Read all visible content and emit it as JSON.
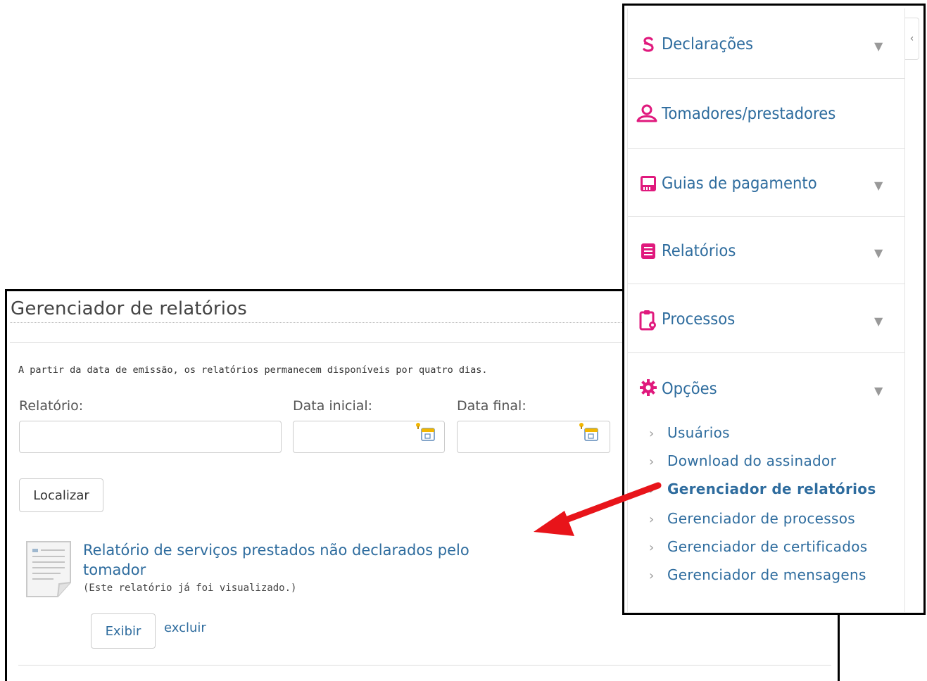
{
  "main": {
    "title": "Gerenciador de relatórios",
    "info": "A partir da data de emissão, os relatórios permanecem disponíveis por quatro dias.",
    "fields": {
      "relatorio_label": "Relatório:",
      "relatorio_value": "",
      "data_inicial_label": "Data inicial:",
      "data_inicial_value": "",
      "data_final_label": "Data final:",
      "data_final_value": ""
    },
    "search_button": "Localizar",
    "report": {
      "title": "Relatório de serviços prestados não declarados pelo tomador",
      "note": "(Este relatório já foi visualizado.)",
      "view_button": "Exibir",
      "delete_link": "excluir"
    }
  },
  "sidebar": {
    "items": [
      {
        "label": "Declarações",
        "icon": "dollar-icon",
        "expandable": true
      },
      {
        "label": "Tomadores/prestadores",
        "icon": "user-icon",
        "expandable": false
      },
      {
        "label": "Guias de pagamento",
        "icon": "payment-slip-icon",
        "expandable": true
      },
      {
        "label": "Relatórios",
        "icon": "report-list-icon",
        "expandable": true
      },
      {
        "label": "Processos",
        "icon": "clipboard-gear-icon",
        "expandable": true
      },
      {
        "label": "Opções",
        "icon": "gear-icon",
        "expandable": true,
        "expanded": true
      }
    ],
    "options_submenu": [
      {
        "label": "Usuários",
        "active": false
      },
      {
        "label": "Download do assinador",
        "active": false
      },
      {
        "label": "Gerenciador de relatórios",
        "active": true
      },
      {
        "label": "Gerenciador de processos",
        "active": false
      },
      {
        "label": "Gerenciador de certificados",
        "active": false
      },
      {
        "label": "Gerenciador de mensagens",
        "active": false
      }
    ]
  },
  "colors": {
    "link": "#2e6c9e",
    "icon_pink": "#e0197d",
    "arrow_red": "#e8141a"
  }
}
